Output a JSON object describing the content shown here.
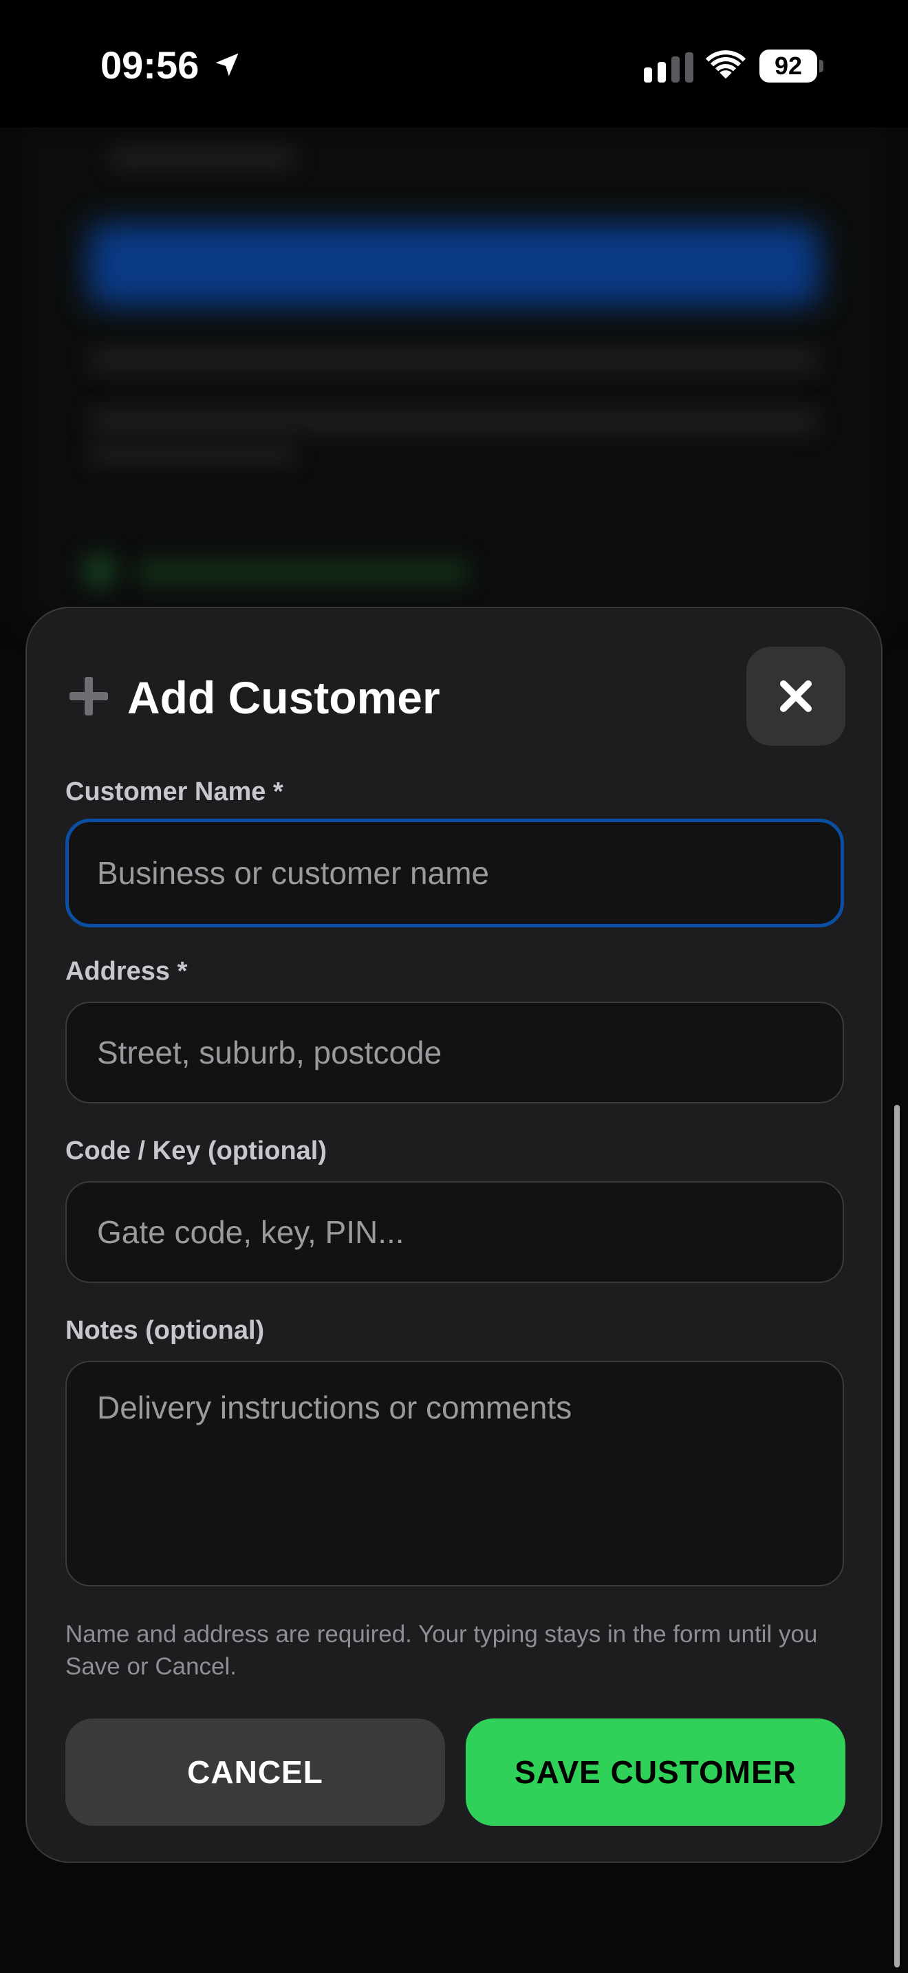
{
  "status_bar": {
    "time": "09:56",
    "battery_level": "92",
    "icons": [
      "location-arrow-icon",
      "cellular-signal-icon",
      "wifi-icon",
      "battery-icon"
    ]
  },
  "modal": {
    "title": "Add Customer",
    "title_icon": "plus-icon",
    "close_icon": "close-icon",
    "fields": {
      "customer_name": {
        "label": "Customer Name *",
        "value": "",
        "placeholder": "Business or customer name",
        "focused": true
      },
      "address": {
        "label": "Address *",
        "value": "",
        "placeholder": "Street, suburb, postcode"
      },
      "code_key": {
        "label": "Code / Key (optional)",
        "value": "",
        "placeholder": "Gate code, key, PIN..."
      },
      "notes": {
        "label": "Notes (optional)",
        "value": "",
        "placeholder": "Delivery instructions or comments"
      }
    },
    "hint": "Name and address are required. Your typing stays in the form until you Save or Cancel.",
    "buttons": {
      "cancel_label": "CANCEL",
      "save_label": "SAVE CUSTOMER"
    }
  },
  "colors": {
    "accent_save": "#30d158",
    "focus_border": "#0a4fa3",
    "sheet_background": "#1d1d1f",
    "field_background": "#121213"
  }
}
